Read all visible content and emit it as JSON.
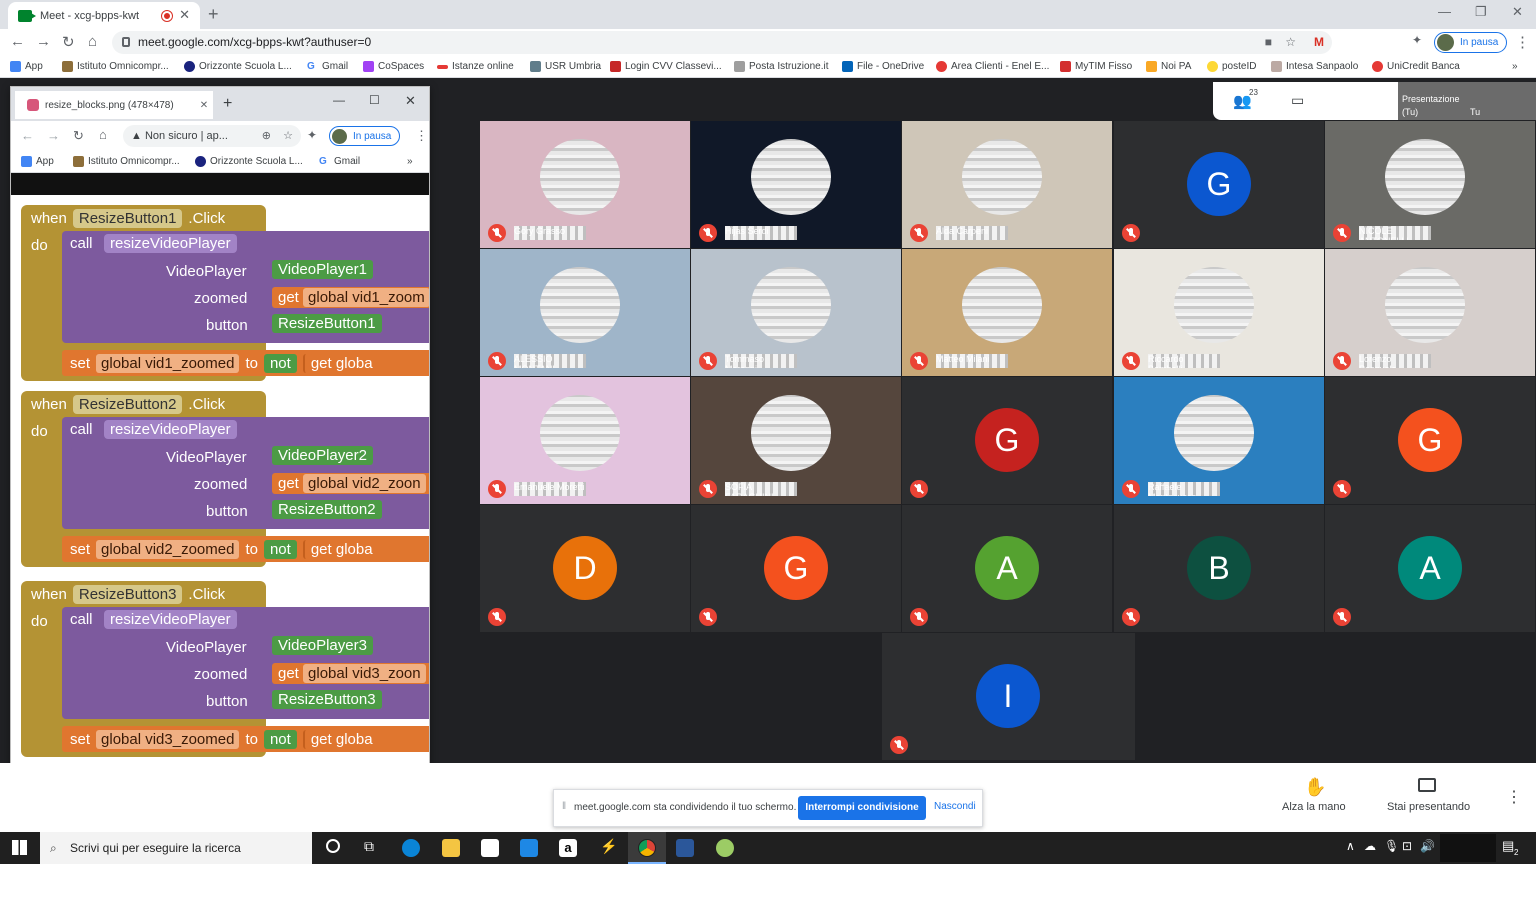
{
  "browser": {
    "tab_title": "Meet - xcg-bpps-kwt",
    "url": "meet.google.com/xcg-bpps-kwt?authuser=0",
    "profile_status": "In pausa",
    "bookmarks": [
      "App",
      "Istituto Omnicompr...",
      "Orizzonte Scuola L...",
      "Gmail",
      "CoSpaces",
      "Istanze online",
      "USR Umbria",
      "Login CVV Classevi...",
      "Posta Istruzione.it",
      "File - OneDrive",
      "Area Clienti - Enel E...",
      "MyTIM Fisso",
      "Noi PA",
      "posteID",
      "Intesa Sanpaolo",
      "UniCredit Banca"
    ],
    "bookmarks_more": "»"
  },
  "meet": {
    "participants_count": "23",
    "self_label": "Presentazione",
    "self_sub": "(Tu)",
    "self_name": "Tu",
    "tiles": [
      {
        "kind": "video",
        "bg": "#d9b6c2",
        "name": "Gory Grasso"
      },
      {
        "kind": "video",
        "bg": "#101828",
        "name": "Hijas Serdi"
      },
      {
        "kind": "video",
        "bg": "#cfc6b8",
        "name": "Alda Carpeni"
      },
      {
        "kind": "avatar",
        "letter": "G",
        "color": "#0b57d0"
      },
      {
        "kind": "video",
        "bg": "#6a6a66",
        "name": "NICOLE ANTONELLI"
      },
      {
        "kind": "video",
        "bg": "#9fb5c9",
        "name": "ALESSIO MONTANI"
      },
      {
        "kind": "video",
        "bg": "#b8c2cc",
        "name": "Tommaso Marconi"
      },
      {
        "kind": "video",
        "bg": "#c8a878",
        "name": "Matteo Milani"
      },
      {
        "kind": "video",
        "bg": "#e9e6df",
        "name": "Riccardo Bombelli"
      },
      {
        "kind": "video",
        "bg": "#d6cfcc",
        "name": "Lorenzo Pasquale"
      },
      {
        "kind": "video",
        "bg": "#e3c3de",
        "name": "Emanuele Moretti"
      },
      {
        "kind": "video",
        "bg": "#55463d",
        "name": "SOFIA FARAGHINI"
      },
      {
        "kind": "avatar",
        "letter": "G",
        "color": "#c5221f"
      },
      {
        "kind": "video",
        "bg": "#2b7fbf",
        "name": "Raffaele Montecucco"
      },
      {
        "kind": "avatar",
        "letter": "G",
        "color": "#f4511e"
      },
      {
        "kind": "avatar",
        "letter": "D",
        "color": "#e8710a"
      },
      {
        "kind": "avatar",
        "letter": "G",
        "color": "#f4511e"
      },
      {
        "kind": "avatar",
        "letter": "A",
        "color": "#55a230"
      },
      {
        "kind": "avatar",
        "letter": "B",
        "color": "#0d5040"
      },
      {
        "kind": "avatar",
        "letter": "A",
        "color": "#00897b"
      },
      {
        "kind": "avatar",
        "letter": "I",
        "color": "#0b57d0"
      }
    ],
    "share_notice": "meet.google.com sta condividendo il tuo schermo.",
    "stop_sharing": "Interrompi condivisione",
    "hide": "Nascondi",
    "raise_hand": "Alza la mano",
    "presenting": "Stai presentando"
  },
  "popup": {
    "tab_title": "resize_blocks.png (478×478)",
    "not_secure": "Non sicuro",
    "addr_short": "ap...",
    "profile_status": "In pausa",
    "bookmarks": [
      "App",
      "Istituto Omnicompr...",
      "Orizzonte Scuola L...",
      "Gmail"
    ],
    "bookmarks_more": "»",
    "blocks": [
      {
        "button": "ResizeButton1",
        "player": "VideoPlayer1",
        "var": "global vid1_zoomed",
        "zoom_get": "global vid1_zoom"
      },
      {
        "button": "ResizeButton2",
        "player": "VideoPlayer2",
        "var": "global vid2_zoomed",
        "zoom_get": "global vid2_zoon"
      },
      {
        "button": "ResizeButton3",
        "player": "VideoPlayer3",
        "var": "global vid3_zoomed",
        "zoom_get": "global vid3_zoon"
      }
    ],
    "kw": {
      "when": "when",
      "click": ".Click",
      "do": "do",
      "call": "call",
      "proc": "resizeVideoPlayer",
      "videoplayer": "VideoPlayer",
      "zoomed": "zoomed",
      "button": "button",
      "set": "set",
      "to": "to",
      "not": "not",
      "get": "get",
      "globa": "globa"
    }
  },
  "taskbar": {
    "search_placeholder": "Scrivi qui per eseguire la ricerca",
    "notif_count": "2"
  }
}
